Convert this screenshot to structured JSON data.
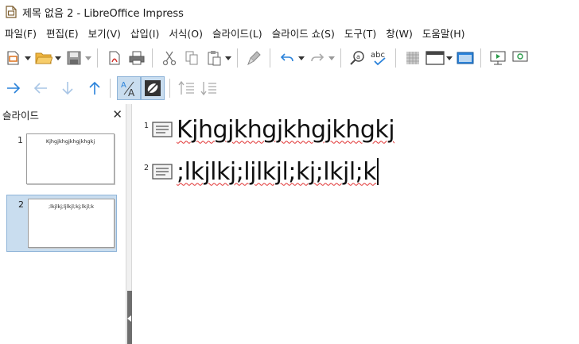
{
  "window": {
    "title": "제목 없음 2 - LibreOffice Impress"
  },
  "menubar": {
    "items": [
      "파일(F)",
      "편집(E)",
      "보기(V)",
      "삽입(I)",
      "서식(O)",
      "슬라이드(L)",
      "슬라이드 쇼(S)",
      "도구(T)",
      "창(W)",
      "도움말(H)"
    ]
  },
  "toolbar1": {
    "icons": [
      "new-document-icon",
      "open-folder-icon",
      "save-icon",
      "export-pdf-icon",
      "print-icon",
      "cut-icon",
      "copy-icon",
      "paste-icon",
      "clone-formatting-icon",
      "undo-icon",
      "redo-icon",
      "find-replace-icon",
      "spelling-icon",
      "display-grid-icon",
      "slide-layout-icon",
      "display-views-icon",
      "start-from-first-icon",
      "start-from-current-icon"
    ]
  },
  "toolbar2": {
    "icons": [
      "arrow-right-icon",
      "arrow-left-icon",
      "arrow-down-icon",
      "arrow-up-icon",
      "formatting-on-off-icon",
      "black-white-view-icon",
      "move-up-icon",
      "move-down-icon"
    ]
  },
  "slide_panel": {
    "title": "슬라이드",
    "close": "✕",
    "slides": [
      {
        "number": "1",
        "title": "Kjhgjkhgjkhgjkhgkj",
        "selected": false
      },
      {
        "number": "2",
        "title": ";lkjlkj;ljlkjl;kj;lkjl;k",
        "selected": true
      }
    ]
  },
  "outline": {
    "entries": [
      {
        "number": "1",
        "text": "Kjhgjkhgjkhgjkhgkj"
      },
      {
        "number": "2",
        "text": ";lkjlkj;ljlkjl;kj;lkjl;k"
      }
    ]
  },
  "colors": {
    "accent": "#2a82da",
    "selection": "#c9ddef",
    "spellcheck": "#e03030"
  }
}
